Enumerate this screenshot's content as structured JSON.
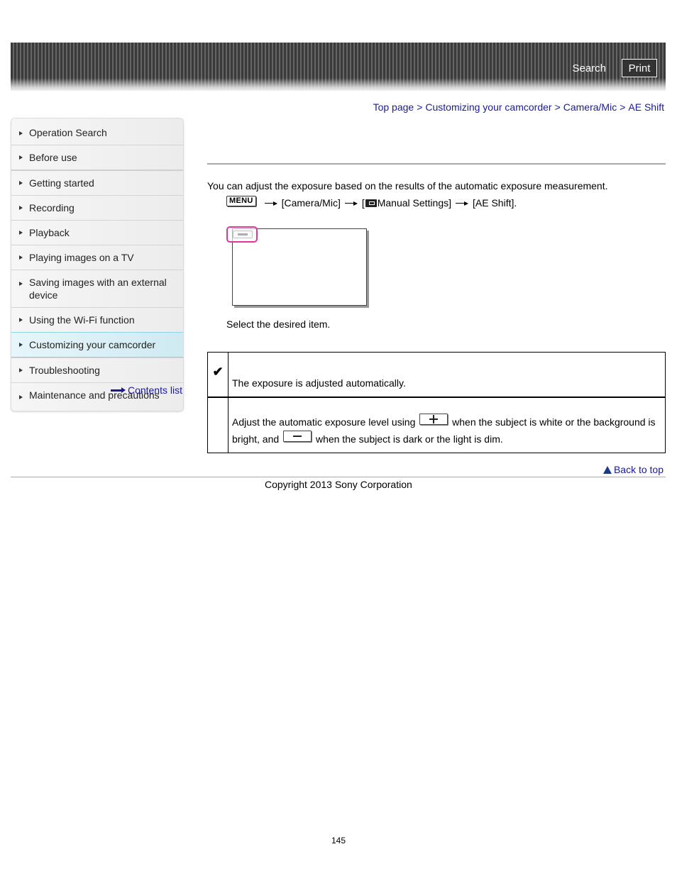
{
  "header": {
    "search_label": "Search",
    "print_label": "Print"
  },
  "breadcrumb": {
    "items": [
      "Top page",
      "Customizing your camcorder",
      "Camera/Mic",
      "AE Shift"
    ],
    "separator": ">"
  },
  "sidebar": {
    "items": [
      {
        "label": "Operation Search",
        "active": false
      },
      {
        "label": "Before use",
        "active": false
      },
      {
        "label": "Getting started",
        "active": false
      },
      {
        "label": "Recording",
        "active": false
      },
      {
        "label": "Playback",
        "active": false
      },
      {
        "label": "Playing images on a TV",
        "active": false
      },
      {
        "label": "Saving images with an external device",
        "active": false
      },
      {
        "label": "Using the Wi-Fi function",
        "active": false
      },
      {
        "label": "Customizing your camcorder",
        "active": true
      },
      {
        "label": "Troubleshooting",
        "active": false
      },
      {
        "label": "Maintenance and precautions",
        "active": false
      }
    ],
    "contents_list_label": "Contents list"
  },
  "main": {
    "intro": "You can adjust the exposure based on the results of the automatic exposure measurement.",
    "steps": {
      "menu_key": "MENU",
      "step1": "[Camera/Mic]",
      "step2_open": "[",
      "step2_label": "Manual Settings]",
      "step3": "[AE Shift]."
    },
    "select_text": "Select the desired item.",
    "options": [
      {
        "selected": true,
        "check_glyph": "✔",
        "description": "The exposure is adjusted automatically."
      },
      {
        "selected": false,
        "desc_part1": "Adjust the automatic exposure level using",
        "desc_part2": "when the subject is white or the background is bright, and",
        "desc_part3": "when the subject is dark or the light is dim."
      }
    ]
  },
  "footer": {
    "back_to_top": "Back to top",
    "copyright": "Copyright 2013 Sony Corporation",
    "page_number": "145"
  }
}
